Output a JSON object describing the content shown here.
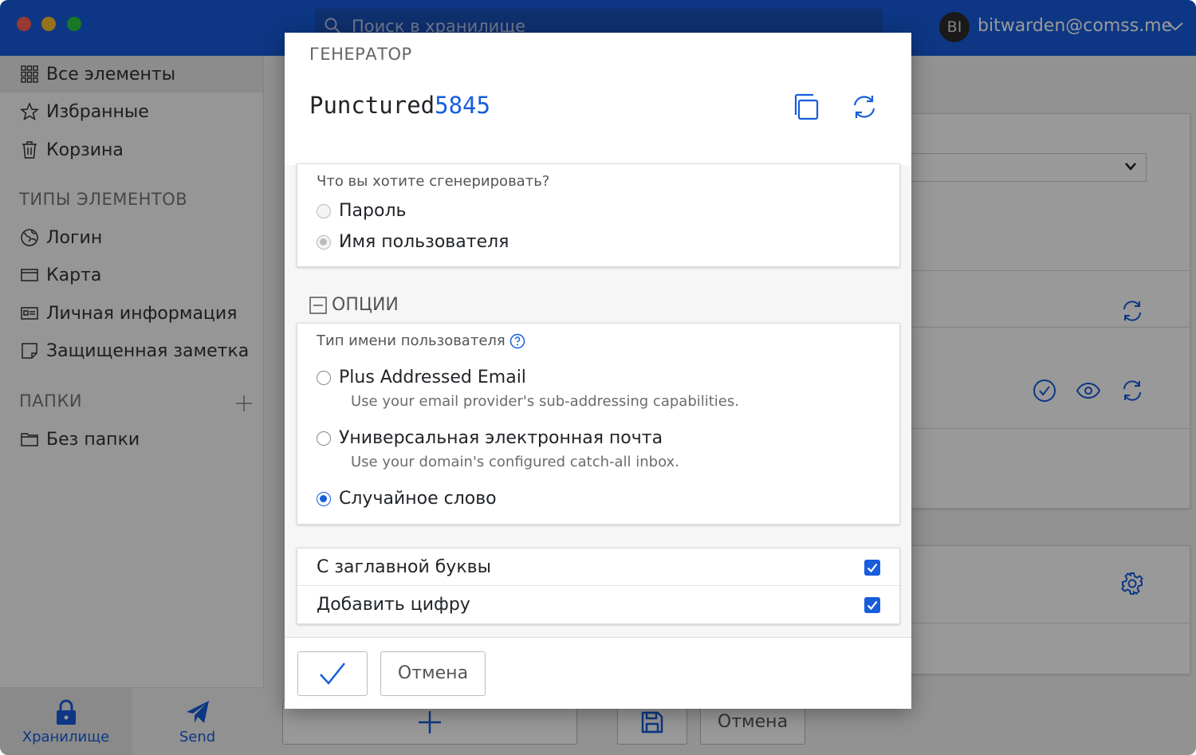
{
  "titlebar": {
    "search_placeholder": "Поиск в хранилище",
    "avatar_initials": "BI",
    "account_email": "bitwarden@comss.me"
  },
  "sidebar": {
    "items": [
      {
        "label": "Все элементы",
        "icon": "grid-icon"
      },
      {
        "label": "Избранные",
        "icon": "star-icon"
      },
      {
        "label": "Корзина",
        "icon": "trash-icon"
      }
    ],
    "types_heading": "ТИПЫ ЭЛЕМЕНТОВ",
    "types": [
      {
        "label": "Логин",
        "icon": "globe-icon"
      },
      {
        "label": "Карта",
        "icon": "credit-card-icon"
      },
      {
        "label": "Личная информация",
        "icon": "id-card-icon"
      },
      {
        "label": "Защищенная заметка",
        "icon": "sticky-note-icon"
      }
    ],
    "folders_heading": "ПАПКИ",
    "folders": [
      {
        "label": "Без папки",
        "icon": "folder-icon"
      }
    ]
  },
  "bottom_nav": {
    "vault_label": "Хранилище",
    "send_label": "Send"
  },
  "background": {
    "cancel_label": "Отмена"
  },
  "generator": {
    "title": "ГЕНЕРАТОР",
    "password_word": "Punctured",
    "password_number": "5845",
    "what_label": "Что вы хотите сгенерировать?",
    "type_options": [
      {
        "label": "Пароль",
        "checked": false
      },
      {
        "label": "Имя пользователя",
        "checked": true
      }
    ],
    "options_heading": "ОПЦИИ",
    "username_type_label": "Тип имени пользователя",
    "username_types": [
      {
        "label": "Plus Addressed Email",
        "desc": "Use your email provider's sub-addressing capabilities.",
        "checked": false
      },
      {
        "label": "Универсальная электронная почта",
        "desc": "Use your domain's configured catch-all inbox.",
        "checked": false
      },
      {
        "label": "Случайное слово",
        "desc": "",
        "checked": true
      }
    ],
    "checkboxes": [
      {
        "label": "С заглавной буквы",
        "checked": true
      },
      {
        "label": "Добавить цифру",
        "checked": true
      }
    ],
    "cancel_label": "Отмена"
  },
  "colors": {
    "brand": "#175ddc",
    "overlay": "rgba(0,0,0,0.4)"
  }
}
